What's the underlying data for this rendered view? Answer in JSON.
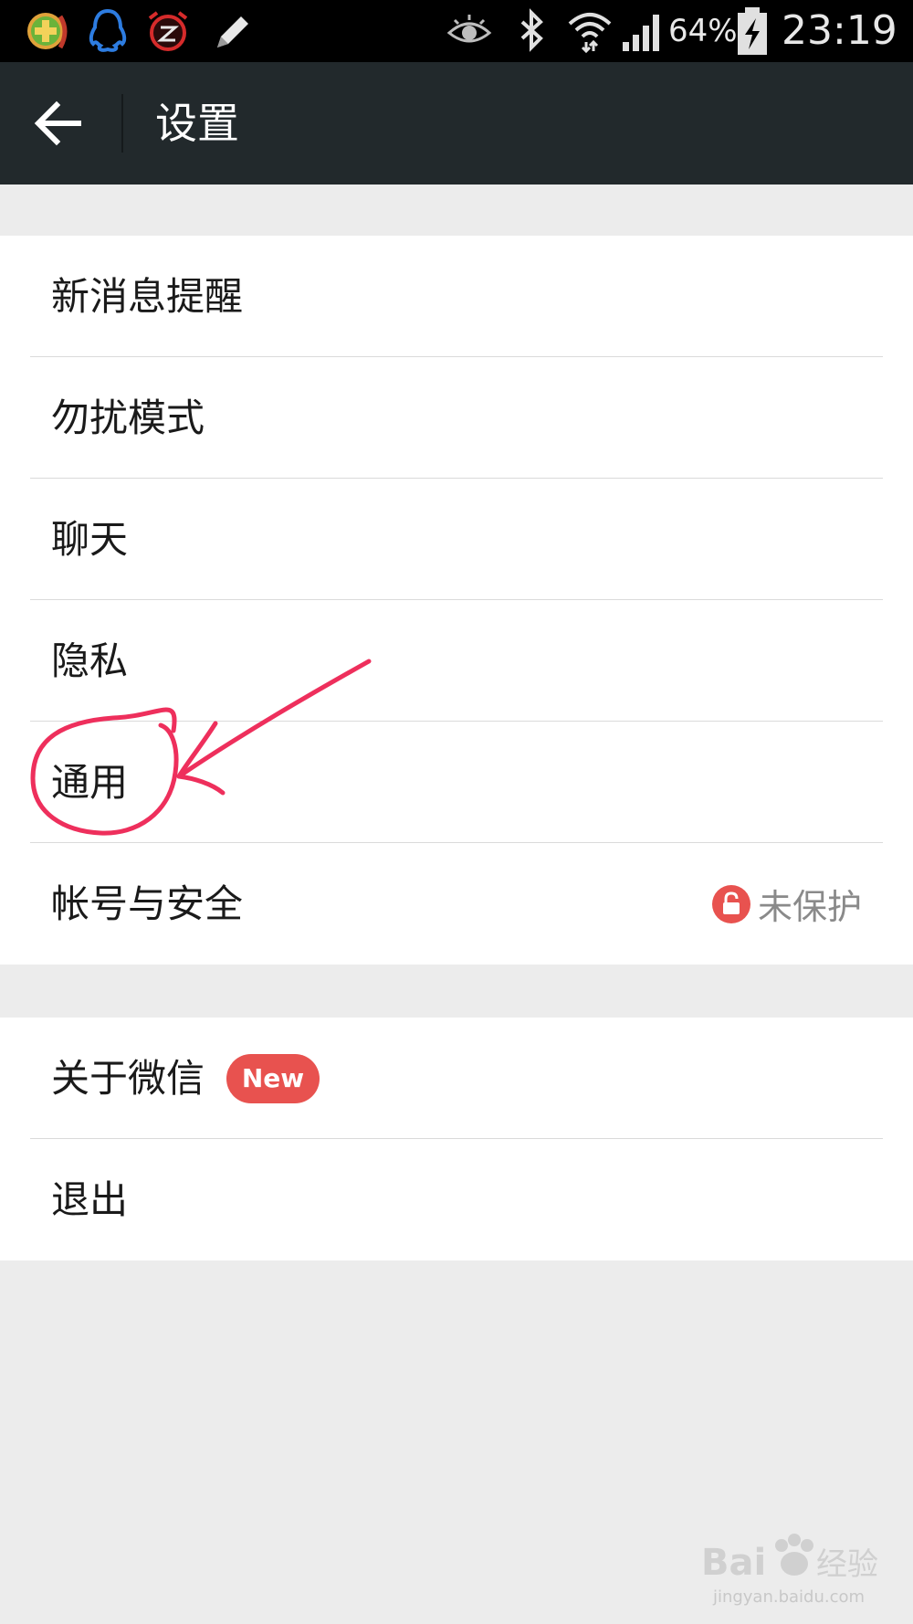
{
  "status_bar": {
    "battery_percent": "64%",
    "time": "23:19",
    "icons": [
      "gamepad-icon",
      "qq-penguin-icon",
      "alarm-clock-icon",
      "pencil-icon",
      "eye-icon",
      "bluetooth-icon",
      "wifi-icon",
      "signal-icon",
      "battery-charging-icon"
    ]
  },
  "toolbar": {
    "title": "设置",
    "back_icon": "arrow-left-icon"
  },
  "settings_group_1": [
    {
      "label": "新消息提醒"
    },
    {
      "label": "勿扰模式"
    },
    {
      "label": "聊天"
    },
    {
      "label": "隐私"
    },
    {
      "label": "通用"
    },
    {
      "label": "帐号与安全",
      "status": "未保护",
      "status_icon": "lock-icon"
    }
  ],
  "settings_group_2": [
    {
      "label": "关于微信",
      "badge": "New"
    },
    {
      "label": "退出"
    }
  ],
  "colors": {
    "toolbar": "#22292c",
    "accent_red": "#e8524f",
    "background": "#ececec"
  },
  "watermark": {
    "brand": "Bai度经验",
    "url": "jingyan.baidu.com"
  }
}
